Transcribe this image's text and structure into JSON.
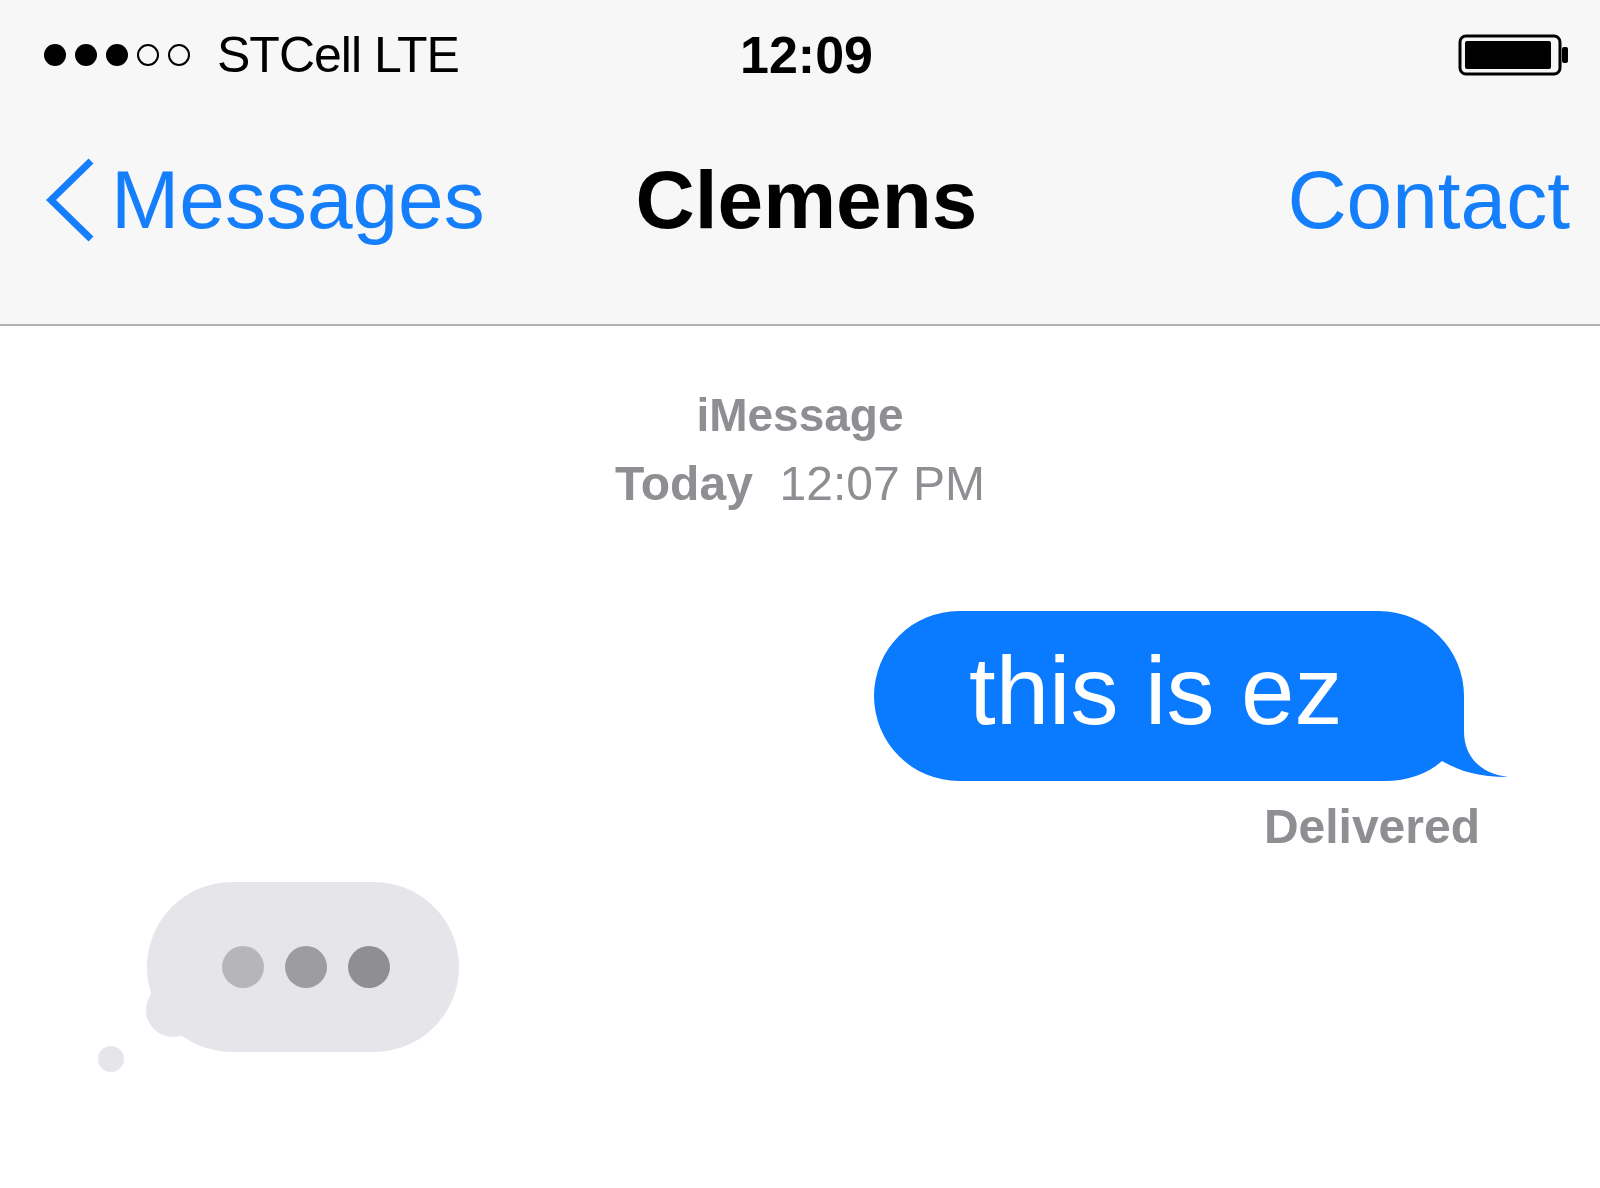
{
  "status_bar": {
    "carrier": "STCell LTE",
    "time": "12:09"
  },
  "nav_bar": {
    "back": "Messages",
    "title": "Clemens",
    "action": "Contact"
  },
  "conversation": {
    "service": "iMessage",
    "timestamp": "**Today**  12:07 PM",
    "messages": [
      {
        "kind": "sent",
        "text": "this is ez",
        "status": "Delivered"
      },
      {
        "kind": "typing"
      }
    ]
  }
}
